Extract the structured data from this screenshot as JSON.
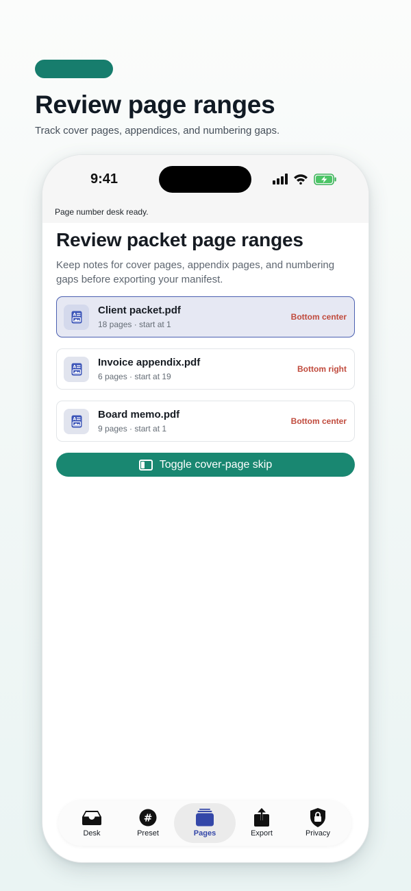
{
  "promo": {
    "title": "Review page ranges",
    "subtitle": "Track cover pages, appendices, and numbering gaps."
  },
  "status_bar": {
    "time": "9:41"
  },
  "banner": "Page number desk ready.",
  "screen": {
    "title": "Review packet page ranges",
    "description": "Keep notes for cover pages, appendix pages, and numbering gaps before exporting your manifest."
  },
  "files": [
    {
      "name": "Client packet.pdf",
      "meta": "18 pages · start at 1",
      "position": "Bottom center",
      "selected": true
    },
    {
      "name": "Invoice appendix.pdf",
      "meta": "6 pages · start at 19",
      "position": "Bottom right",
      "selected": false
    },
    {
      "name": "Board memo.pdf",
      "meta": "9 pages · start at 1",
      "position": "Bottom center",
      "selected": false
    }
  ],
  "toggle_button": {
    "label": "Toggle cover-page skip"
  },
  "tabs": [
    {
      "label": "Desk",
      "icon": "inbox-tray-icon"
    },
    {
      "label": "Preset",
      "icon": "hash-icon"
    },
    {
      "label": "Pages",
      "icon": "pages-stack-icon",
      "active": true
    },
    {
      "label": "Export",
      "icon": "share-export-icon"
    },
    {
      "label": "Privacy",
      "icon": "lock-shield-icon"
    }
  ],
  "colors": {
    "accent": "#198771",
    "selected_border": "#4a5fb0",
    "position_text": "#c04a3c",
    "active_tab": "#3447a8"
  }
}
